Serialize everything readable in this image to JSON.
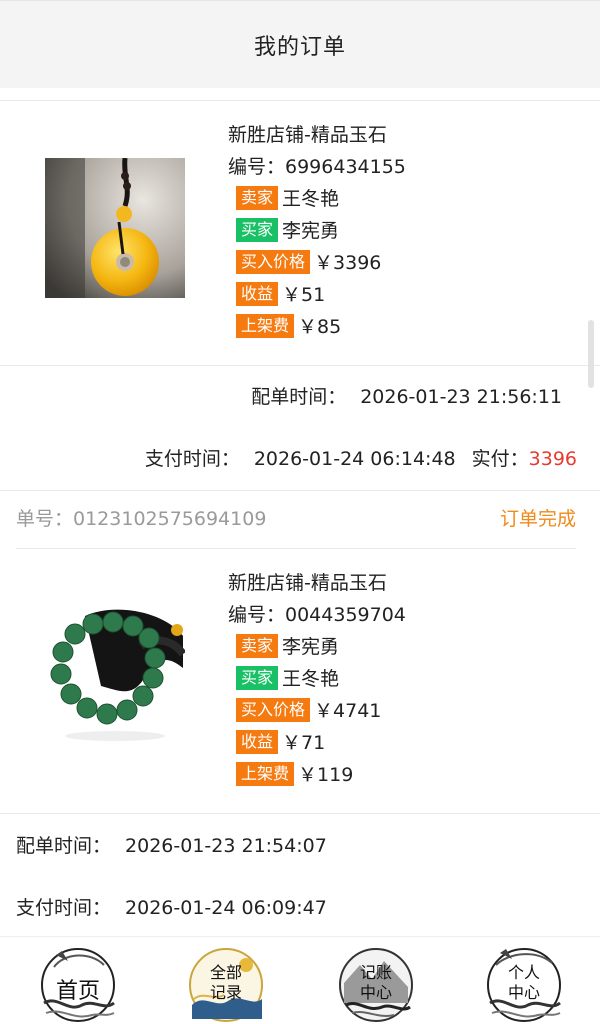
{
  "header": {
    "title": "我的订单"
  },
  "orders": [
    {
      "shop": "新胜店铺-精品玉石",
      "item_no": "编号：6996434155",
      "seller_tag": "卖家",
      "seller": "王冬艳",
      "buyer_tag": "买家",
      "buyer": "李宪勇",
      "price_tag": "买入价格",
      "price": "￥3396",
      "profit_tag": "收益",
      "profit": "￥51",
      "fee_tag": "上架费",
      "fee": "￥85",
      "match_label": "配单时间：",
      "match_time": "2026-01-23 21:56:11",
      "pay_label": "支付时间：",
      "pay_time": "2026-01-24 06:14:48",
      "paid_label": "实付：",
      "paid": "3396"
    },
    {
      "order_no": "单号：0123102575694109",
      "status": "订单完成",
      "shop": "新胜店铺-精品玉石",
      "item_no": "编号：0044359704",
      "seller_tag": "卖家",
      "seller": "李宪勇",
      "buyer_tag": "买家",
      "buyer": "王冬艳",
      "price_tag": "买入价格",
      "price": "￥4741",
      "profit_tag": "收益",
      "profit": "￥71",
      "fee_tag": "上架费",
      "fee": "￥119",
      "match_label": "配单时间：",
      "match_time": "2026-01-23 21:54:07",
      "pay_label": "支付时间：",
      "pay_time": "2026-01-24 06:09:47"
    }
  ],
  "tabs": [
    {
      "label": "首页",
      "icon": "home-icon"
    },
    {
      "label1": "全部",
      "label2": "记录",
      "icon": "records-icon"
    },
    {
      "label1": "记账",
      "label2": "中心",
      "icon": "accounting-icon"
    },
    {
      "label1": "个人",
      "label2": "中心",
      "icon": "profile-icon"
    }
  ],
  "colors": {
    "tag_orange": "#f57a10",
    "tag_green": "#19c065",
    "paid_red": "#e63b2e",
    "status_orange": "#f08a1a"
  }
}
